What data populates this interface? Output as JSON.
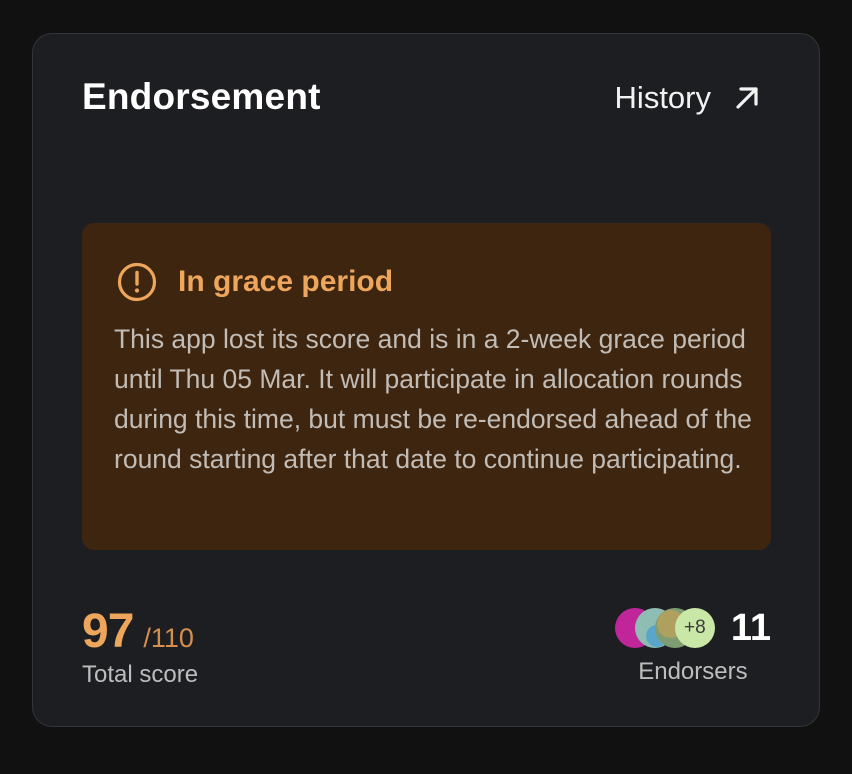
{
  "card": {
    "title": "Endorsement",
    "history_label": "History"
  },
  "alert": {
    "icon": "alert-circle-icon",
    "title": "In grace period",
    "body": "This app lost its score and is in a 2-week grace period until Thu 05 Mar. It will participate in allocation rounds during this time, but must be re-endorsed ahead of the round starting after that date to continue participating.",
    "accent": "#eea55c",
    "background": "#3d2510"
  },
  "score": {
    "value": "97",
    "max": "/110",
    "label": "Total score"
  },
  "endorsers": {
    "avatar_colors": [
      "#c0259a",
      "#8fbdb3",
      "#9da36e"
    ],
    "more_label": "+8",
    "count": "11",
    "label": "Endorsers"
  }
}
